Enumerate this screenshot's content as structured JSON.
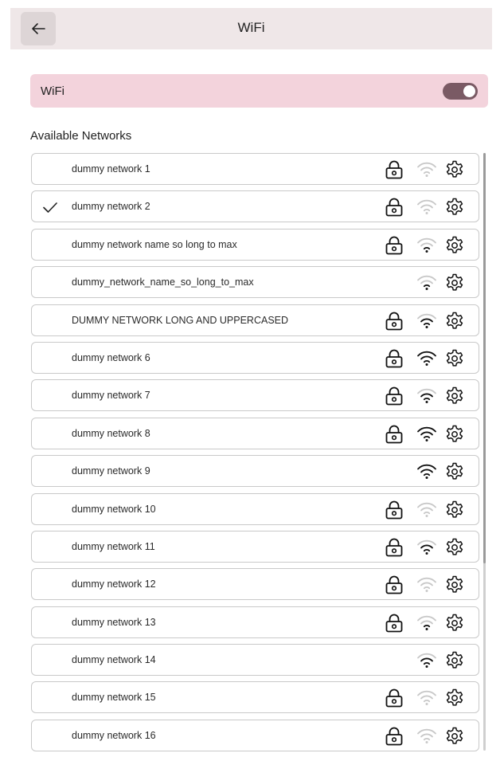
{
  "header": {
    "title": "WiFi",
    "back_icon": "arrow-left-icon"
  },
  "wifi_toggle": {
    "label": "WiFi",
    "enabled": true,
    "track_color": "#7a5a64",
    "row_color": "#f3d3dc"
  },
  "section": {
    "title": "Available Networks"
  },
  "colors": {
    "signal_strong": "#111111",
    "signal_weak": "#c8c8c8",
    "header_bg": "#efe7e8"
  },
  "networks": [
    {
      "name": "dummy network 1",
      "connected": false,
      "secured": true,
      "signal": 0
    },
    {
      "name": "dummy network 2",
      "connected": true,
      "secured": true,
      "signal": 0
    },
    {
      "name": "dummy network name so long to max",
      "connected": false,
      "secured": true,
      "signal": 1
    },
    {
      "name": "dummy_network_name_so_long_to_max",
      "connected": false,
      "secured": false,
      "signal": 1
    },
    {
      "name": "DUMMY NETWORK LONG AND UPPERCASED",
      "connected": false,
      "secured": true,
      "signal": 2
    },
    {
      "name": "dummy network 6",
      "connected": false,
      "secured": true,
      "signal": 3
    },
    {
      "name": "dummy network 7",
      "connected": false,
      "secured": true,
      "signal": 2
    },
    {
      "name": "dummy network 8",
      "connected": false,
      "secured": true,
      "signal": 3
    },
    {
      "name": "dummy network 9",
      "connected": false,
      "secured": false,
      "signal": 3
    },
    {
      "name": "dummy network 10",
      "connected": false,
      "secured": true,
      "signal": 0
    },
    {
      "name": "dummy network 11",
      "connected": false,
      "secured": true,
      "signal": 2
    },
    {
      "name": "dummy network 12",
      "connected": false,
      "secured": true,
      "signal": 0
    },
    {
      "name": "dummy network 13",
      "connected": false,
      "secured": true,
      "signal": 1
    },
    {
      "name": "dummy network 14",
      "connected": false,
      "secured": false,
      "signal": 2
    },
    {
      "name": "dummy network 15",
      "connected": false,
      "secured": true,
      "signal": 0
    },
    {
      "name": "dummy network 16",
      "connected": false,
      "secured": true,
      "signal": 0
    }
  ]
}
